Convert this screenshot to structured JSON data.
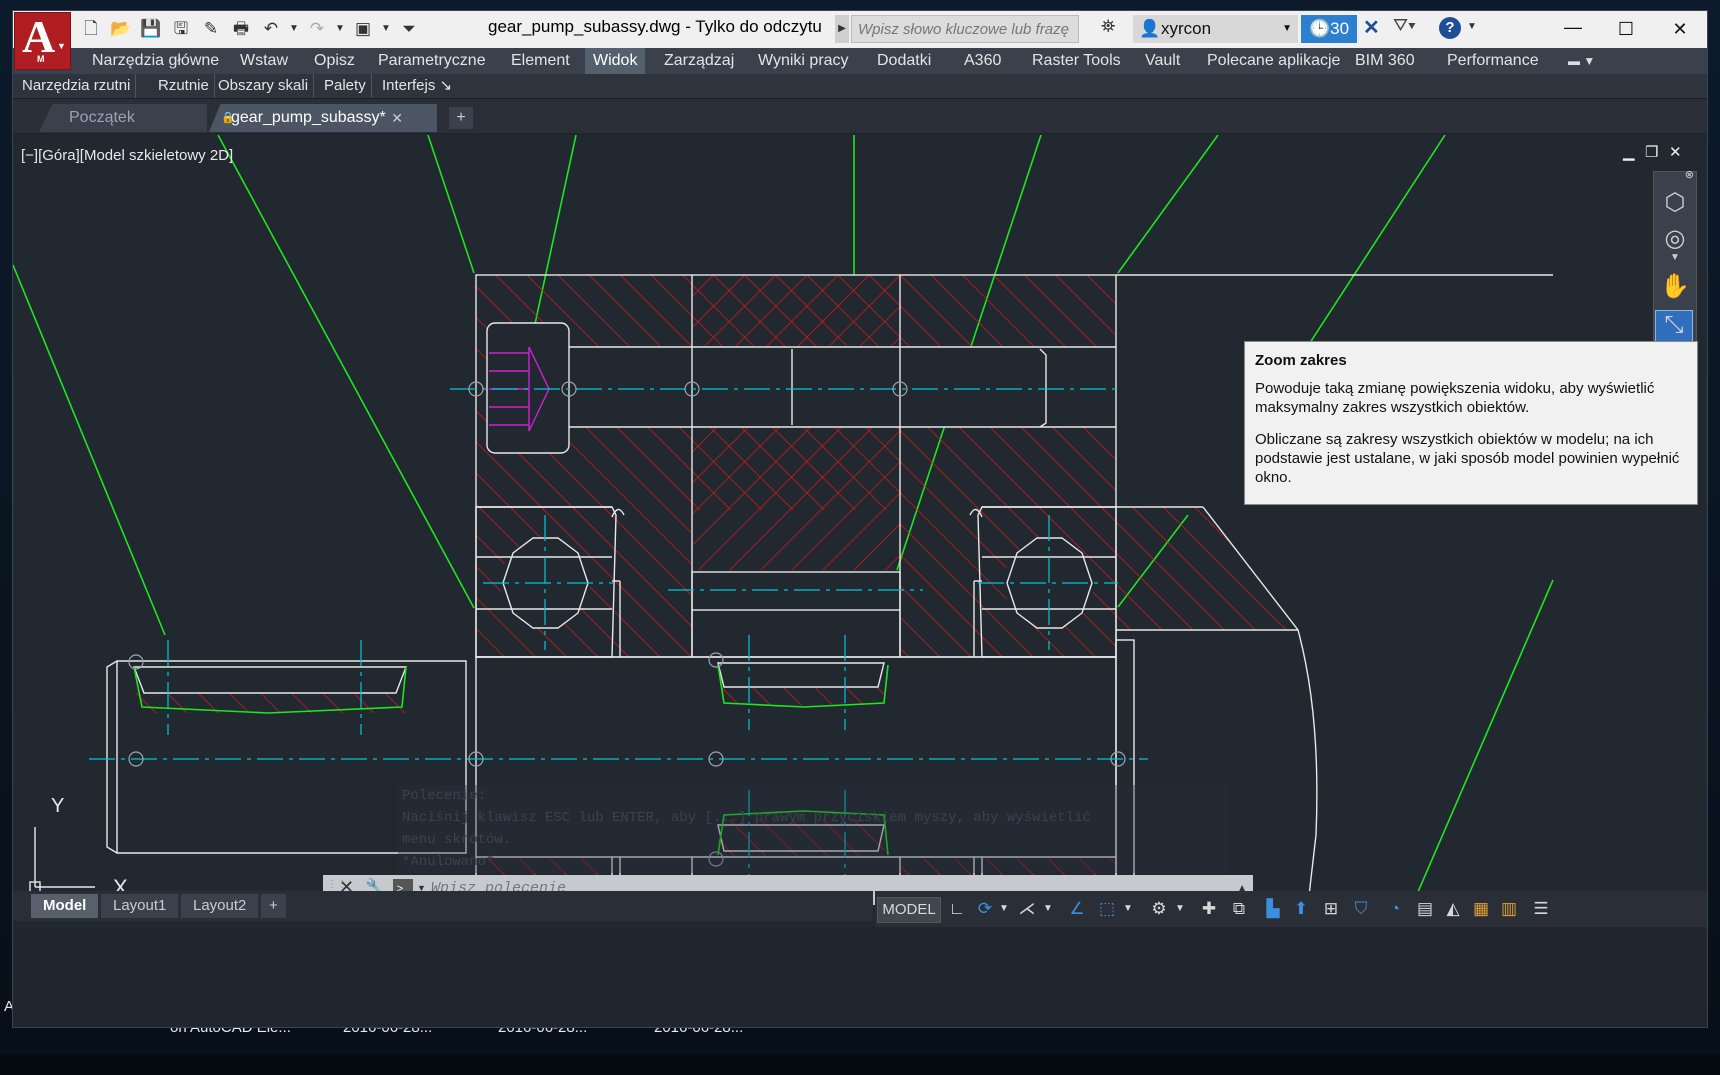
{
  "window": {
    "title": "gear_pump_subassy.dwg - Tylko do odczytu",
    "app_letter": "A",
    "app_sub": "M"
  },
  "search": {
    "placeholder": "Wpisz słowo kluczowe lub frazę"
  },
  "user": {
    "name": "xyrcon"
  },
  "trial": {
    "days": "30"
  },
  "ribbon_tabs": [
    {
      "label": "Narzędzia główne"
    },
    {
      "label": "Wstaw"
    },
    {
      "label": "Opisz"
    },
    {
      "label": "Parametryczne"
    },
    {
      "label": "Element"
    },
    {
      "label": "Widok",
      "active": true
    },
    {
      "label": "Zarządzaj"
    },
    {
      "label": "Wyniki pracy"
    },
    {
      "label": "Dodatki"
    },
    {
      "label": "A360"
    },
    {
      "label": "Raster Tools"
    },
    {
      "label": "Vault"
    },
    {
      "label": "Polecane aplikacje"
    },
    {
      "label": "BIM 360"
    },
    {
      "label": "Performance"
    }
  ],
  "panels": [
    {
      "label": "Narzędzia rzutni"
    },
    {
      "label": "Rzutnie"
    },
    {
      "label": "Obszary skali"
    },
    {
      "label": "Palety"
    },
    {
      "label": "Interfejs ↘"
    }
  ],
  "file_tabs": {
    "start": "Początek",
    "current": "gear_pump_subassy*"
  },
  "viewport": {
    "label": "[−][Góra][Model szkieletowy 2D]"
  },
  "tooltip": {
    "title": "Zoom zakres",
    "p1": "Powoduje taką zmianę powiększenia widoku, aby wyświetlić maksymalny zakres wszystkich obiektów.",
    "p2": "Obliczane są zakresy wszystkich obiektów w modelu; na ich podstawie jest ustalane, w jaki sposób model powinien wypełnić okno."
  },
  "command": {
    "history": [
      "Polecenie:",
      "Naciśnij klawisz ESC lub ENTER, aby [...] prawym przyciskiem myszy, aby wyświetlić",
      "menu skrótów.",
      "*Anulowano*"
    ],
    "placeholder": "Wpisz polecenie"
  },
  "ucs": {
    "x": "X",
    "y": "Y"
  },
  "layout_tabs": [
    "Model",
    "Layout1",
    "Layout2"
  ],
  "status": {
    "model": "MODEL"
  },
  "desktop": {
    "letter": "A",
    "files": [
      "on AutoCAD Ele...",
      "2016-06-28...",
      "2016-06-28...",
      "2016-06-28..."
    ]
  },
  "colors": {
    "canvas": "#212830",
    "hatch": "#e01818",
    "leader": "#1ee61e",
    "center": "#00c8d8",
    "magenta": "#d020d0",
    "accent": "#2d7fd0"
  },
  "icons": [
    "new-icon",
    "open-icon",
    "save-icon",
    "saveas-icon",
    "plot-icon",
    "undo-icon",
    "redo-icon",
    "binoculars-icon",
    "user-icon",
    "exchange-icon",
    "a360-icon",
    "help-icon",
    "viewcube-icon",
    "steering-wheel-icon",
    "pan-icon",
    "zoom-extents-icon",
    "wrench-icon",
    "prompt-icon",
    "grid-icon",
    "snap-icon",
    "ortho-icon",
    "polar-icon",
    "osnap-icon",
    "settings-icon",
    "menu-icon"
  ]
}
